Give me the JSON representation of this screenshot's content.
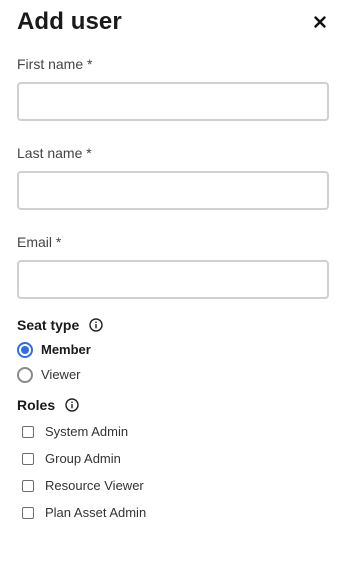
{
  "dialog": {
    "title": "Add user",
    "close_icon": "close-icon"
  },
  "form": {
    "first_name": {
      "label": "First name *",
      "value": "",
      "placeholder": ""
    },
    "last_name": {
      "label": "Last name *",
      "value": "",
      "placeholder": ""
    },
    "email": {
      "label": "Email *",
      "value": "",
      "placeholder": ""
    }
  },
  "seat_type": {
    "label": "Seat type",
    "info_icon": "info-icon",
    "options": [
      {
        "label": "Member",
        "selected": true
      },
      {
        "label": "Viewer",
        "selected": false
      }
    ]
  },
  "roles": {
    "label": "Roles",
    "info_icon": "info-icon",
    "options": [
      {
        "label": "System Admin",
        "checked": false
      },
      {
        "label": "Group Admin",
        "checked": false
      },
      {
        "label": "Resource Viewer",
        "checked": false
      },
      {
        "label": "Plan Asset Admin",
        "checked": false
      }
    ]
  },
  "colors": {
    "accent": "#2f6fd6",
    "input_border": "#d0d0d0",
    "text": "#222222"
  }
}
